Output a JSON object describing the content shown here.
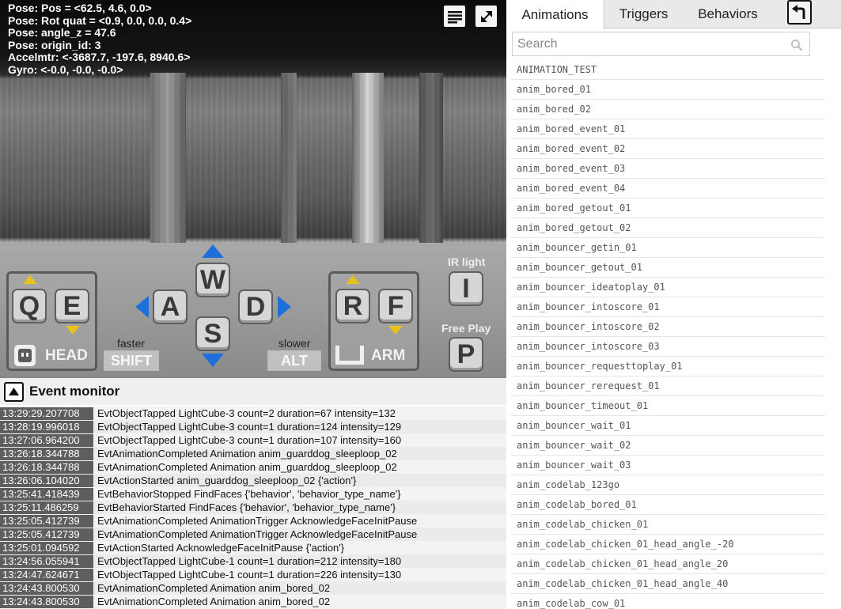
{
  "camera": {
    "pose_lines": [
      "Pose: Pos = <62.5, 4.6, 0.0>",
      "Pose: Rot quat = <0.9, 0.0, 0.0, 0.4>",
      "Pose: angle_z = 47.6",
      "Pose: origin_id: 3",
      "Accelmtr: <-3687.7, -197.6, 8940.6>",
      "Gyro: <-0.0, -0.0, -0.0>"
    ],
    "toolbar_icons": [
      "list-icon",
      "expand-icon"
    ]
  },
  "controls": {
    "head": {
      "keys": [
        "Q",
        "E"
      ],
      "label": "HEAD"
    },
    "drive": {
      "up": "W",
      "left": "A",
      "down": "S",
      "right": "D"
    },
    "faster_label": "faster",
    "shift_key": "SHIFT",
    "slower_label": "slower",
    "alt_key": "ALT",
    "arm": {
      "keys": [
        "R",
        "F"
      ],
      "label": "ARM"
    },
    "ir_light_label": "IR light",
    "ir_key": "I",
    "free_play_label": "Free Play",
    "free_play_key": "P",
    "accent_color": "#1e6fd9",
    "arrow_color": "#e6c21a"
  },
  "event_monitor": {
    "title": "Event monitor",
    "events": [
      {
        "time": "13:29:29.207708",
        "text": "EvtObjectTapped LightCube-3 count=2 duration=67 intensity=132"
      },
      {
        "time": "13:28:19.996018",
        "text": "EvtObjectTapped LightCube-3 count=1 duration=124 intensity=129"
      },
      {
        "time": "13:27:06.964200",
        "text": "EvtObjectTapped LightCube-3 count=1 duration=107 intensity=160"
      },
      {
        "time": "13:26:18.344788",
        "text": "EvtAnimationCompleted Animation anim_guarddog_sleeploop_02"
      },
      {
        "time": "13:26:18.344788",
        "text": "EvtAnimationCompleted Animation anim_guarddog_sleeploop_02"
      },
      {
        "time": "13:26:06.104020",
        "text": "EvtActionStarted anim_guarddog_sleeploop_02 {'action'}"
      },
      {
        "time": "13:25:41.418439",
        "text": "EvtBehaviorStopped FindFaces {'behavior', 'behavior_type_name'}"
      },
      {
        "time": "13:25:11.486259",
        "text": "EvtBehaviorStarted FindFaces {'behavior', 'behavior_type_name'}"
      },
      {
        "time": "13:25:05.412739",
        "text": "EvtAnimationCompleted AnimationTrigger AcknowledgeFaceInitPause"
      },
      {
        "time": "13:25:05.412739",
        "text": "EvtAnimationCompleted AnimationTrigger AcknowledgeFaceInitPause"
      },
      {
        "time": "13:25:01.094592",
        "text": "EvtActionStarted AcknowledgeFaceInitPause {'action'}"
      },
      {
        "time": "13:24:56.055941",
        "text": "EvtObjectTapped LightCube-1 count=1 duration=212 intensity=180"
      },
      {
        "time": "13:24:47.624671",
        "text": "EvtObjectTapped LightCube-1 count=1 duration=226 intensity=130"
      },
      {
        "time": "13:24:43.800530",
        "text": "EvtAnimationCompleted Animation anim_bored_02"
      },
      {
        "time": "13:24:43.800530",
        "text": "EvtAnimationCompleted Animation anim_bored_02"
      }
    ]
  },
  "sidebar": {
    "tabs": [
      {
        "label": "Animations",
        "active": true
      },
      {
        "label": "Triggers",
        "active": false
      },
      {
        "label": "Behaviors",
        "active": false
      }
    ],
    "back_icon": "undo-icon",
    "search": {
      "placeholder": "Search",
      "value": ""
    },
    "animations": [
      "ANIMATION_TEST",
      "anim_bored_01",
      "anim_bored_02",
      "anim_bored_event_01",
      "anim_bored_event_02",
      "anim_bored_event_03",
      "anim_bored_event_04",
      "anim_bored_getout_01",
      "anim_bored_getout_02",
      "anim_bouncer_getin_01",
      "anim_bouncer_getout_01",
      "anim_bouncer_ideatoplay_01",
      "anim_bouncer_intoscore_01",
      "anim_bouncer_intoscore_02",
      "anim_bouncer_intoscore_03",
      "anim_bouncer_requesttoplay_01",
      "anim_bouncer_rerequest_01",
      "anim_bouncer_timeout_01",
      "anim_bouncer_wait_01",
      "anim_bouncer_wait_02",
      "anim_bouncer_wait_03",
      "anim_codelab_123go",
      "anim_codelab_bored_01",
      "anim_codelab_chicken_01",
      "anim_codelab_chicken_01_head_angle_-20",
      "anim_codelab_chicken_01_head_angle_20",
      "anim_codelab_chicken_01_head_angle_40",
      "anim_codelab_cow_01"
    ]
  }
}
